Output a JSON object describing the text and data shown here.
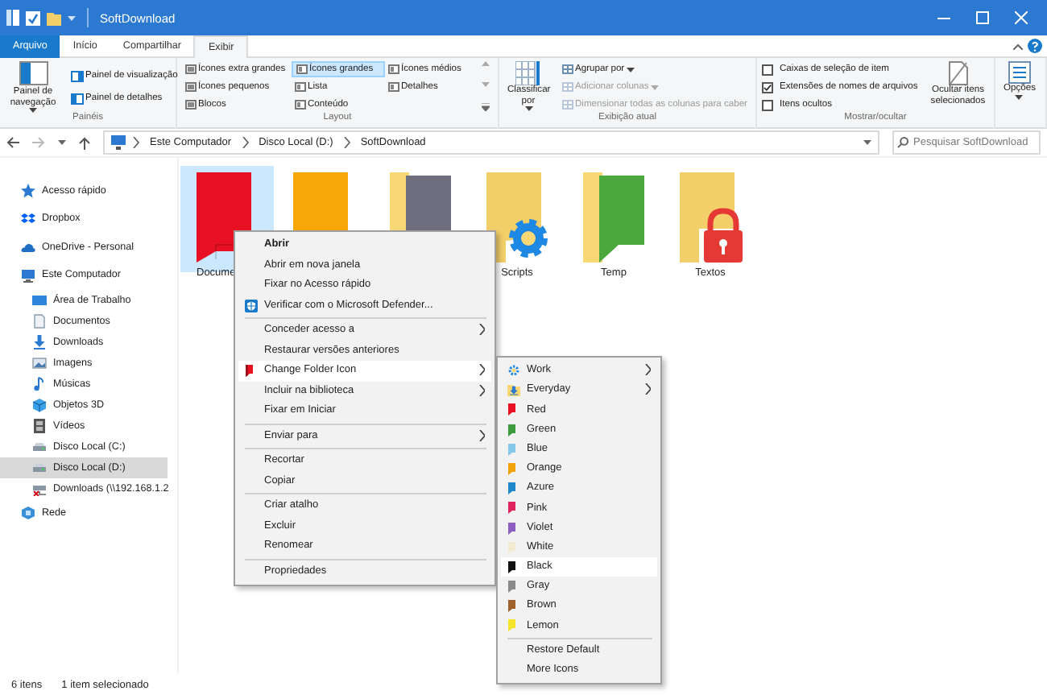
{
  "title_bar": {
    "title": "SoftDownload"
  },
  "ribbon": {
    "tabs": [
      {
        "label": "Arquivo",
        "kind": "file",
        "selected": false
      },
      {
        "label": "Início",
        "kind": "tab",
        "selected": false
      },
      {
        "label": "Compartilhar",
        "kind": "tab",
        "selected": false
      },
      {
        "label": "Exibir",
        "kind": "tab",
        "selected": true
      }
    ],
    "panes": {
      "label": "Painéis",
      "navigation_pane": "Painel de navegação",
      "buttons": [
        "Painel de visualização",
        "Painel de detalhes"
      ]
    },
    "layout": {
      "label": "Layout",
      "options": [
        {
          "label": "Ícones extra grandes",
          "selected": false
        },
        {
          "label": "Ícones grandes",
          "selected": true
        },
        {
          "label": "Ícones médios",
          "selected": false
        },
        {
          "label": "Ícones pequenos",
          "selected": false
        },
        {
          "label": "Lista",
          "selected": false
        },
        {
          "label": "Detalhes",
          "selected": false
        },
        {
          "label": "Blocos",
          "selected": false
        },
        {
          "label": "Conteúdo",
          "selected": false
        }
      ]
    },
    "current_view": {
      "label": "Exibição atual",
      "sort_by": "Classificar por",
      "commands": [
        {
          "label": "Agrupar por",
          "disabled": false,
          "dropdown": true
        },
        {
          "label": "Adicionar colunas",
          "disabled": true,
          "dropdown": true
        },
        {
          "label": "Dimensionar todas as colunas para caber",
          "disabled": true,
          "dropdown": false
        }
      ]
    },
    "show_hide": {
      "label": "Mostrar/ocultar",
      "checkboxes": [
        {
          "label": "Caixas de seleção de item",
          "checked": false
        },
        {
          "label": "Extensões de nomes de arquivos",
          "checked": true
        },
        {
          "label": "Itens ocultos",
          "checked": false
        }
      ],
      "hide_selected": "Ocultar itens selecionados"
    },
    "options": "Opções"
  },
  "address_bar": {
    "path": [
      "Este Computador",
      "Disco Local (D:)",
      "SoftDownload"
    ]
  },
  "search": {
    "placeholder": "Pesquisar SoftDownload"
  },
  "sidebar": {
    "items": [
      {
        "label": "Acesso rápido",
        "kind": "star",
        "selected": false
      },
      {
        "label": "Dropbox",
        "kind": "dropbox",
        "selected": false
      },
      {
        "label": "OneDrive - Personal",
        "kind": "cloud",
        "selected": false
      },
      {
        "label": "Este Computador",
        "kind": "computer",
        "selected": false,
        "children": [
          {
            "label": "Área de Trabalho",
            "kind": "desktop",
            "selected": false
          },
          {
            "label": "Documentos",
            "kind": "document",
            "selected": false
          },
          {
            "label": "Downloads",
            "kind": "download",
            "selected": false
          },
          {
            "label": "Imagens",
            "kind": "image",
            "selected": false
          },
          {
            "label": "Músicas",
            "kind": "music",
            "selected": false
          },
          {
            "label": "Objetos 3D",
            "kind": "cube",
            "selected": false
          },
          {
            "label": "Vídeos",
            "kind": "video",
            "selected": false
          },
          {
            "label": "Disco Local (C:)",
            "kind": "drive",
            "selected": false
          },
          {
            "label": "Disco Local (D:)",
            "kind": "drive",
            "selected": true
          },
          {
            "label": "Downloads (\\\\192.168.1.2",
            "kind": "network-drive",
            "selected": false
          }
        ]
      },
      {
        "label": "Rede",
        "kind": "network",
        "selected": false
      }
    ]
  },
  "files": [
    {
      "name": "Docume",
      "kind": "solid",
      "color": "#e81123",
      "selected": true
    },
    {
      "kind": "solid",
      "color": "#f7a707",
      "selected": false
    },
    {
      "kind": "front",
      "color": "#6e6e7e",
      "selected": false
    },
    {
      "name": "Scripts",
      "kind": "gear",
      "color": "#f3cf6a",
      "selected": false
    },
    {
      "name": "Temp",
      "kind": "front",
      "color": "#4aa83c",
      "selected": false
    },
    {
      "name": "Textos",
      "kind": "lock",
      "color": "#f3cf6a",
      "selected": false
    }
  ],
  "context_menu": {
    "items": [
      {
        "kind": "item",
        "label": "Abrir",
        "bold": true,
        "submenu": false,
        "highlighted": false
      },
      {
        "kind": "item",
        "label": "Abrir em nova janela",
        "bold": false,
        "submenu": false,
        "highlighted": false
      },
      {
        "kind": "item",
        "label": "Fixar no Acesso rápido",
        "bold": false,
        "submenu": false,
        "highlighted": false
      },
      {
        "kind": "shield",
        "label": "Verificar com o Microsoft Defender...",
        "bold": false,
        "submenu": false,
        "highlighted": false
      },
      {
        "kind": "separator"
      },
      {
        "kind": "item",
        "label": "Conceder acesso a",
        "bold": false,
        "submenu": true,
        "highlighted": false
      },
      {
        "kind": "item",
        "label": "Restaurar versões anteriores",
        "bold": false,
        "submenu": false,
        "highlighted": false
      },
      {
        "kind": "flag",
        "label": "Change Folder Icon",
        "bold": false,
        "submenu": true,
        "highlighted": true
      },
      {
        "kind": "item",
        "label": "Incluir na biblioteca",
        "bold": false,
        "submenu": true,
        "highlighted": false
      },
      {
        "kind": "item",
        "label": "Fixar em Iniciar",
        "bold": false,
        "submenu": false,
        "highlighted": false
      },
      {
        "kind": "separator"
      },
      {
        "kind": "item",
        "label": "Enviar para",
        "bold": false,
        "submenu": true,
        "highlighted": false
      },
      {
        "kind": "separator"
      },
      {
        "kind": "item",
        "label": "Recortar",
        "bold": false,
        "submenu": false,
        "highlighted": false
      },
      {
        "kind": "item",
        "label": "Copiar",
        "bold": false,
        "submenu": false,
        "highlighted": false
      },
      {
        "kind": "separator"
      },
      {
        "kind": "item",
        "label": "Criar atalho",
        "bold": false,
        "submenu": false,
        "highlighted": false
      },
      {
        "kind": "item",
        "label": "Excluir",
        "bold": false,
        "submenu": false,
        "highlighted": false
      },
      {
        "kind": "item",
        "label": "Renomear",
        "bold": false,
        "submenu": false,
        "highlighted": false
      },
      {
        "kind": "separator"
      },
      {
        "kind": "item",
        "label": "Propriedades",
        "bold": false,
        "submenu": false,
        "highlighted": false
      }
    ]
  },
  "submenu": {
    "items": [
      {
        "kind": "gear",
        "label": "Work",
        "submenu": true,
        "highlighted": false
      },
      {
        "kind": "download",
        "label": "Everyday",
        "submenu": true,
        "highlighted": false
      },
      {
        "kind": "swatch",
        "label": "Red",
        "color": "#e81123",
        "submenu": false,
        "highlighted": false
      },
      {
        "kind": "swatch",
        "label": "Green",
        "color": "#3a9c3a",
        "submenu": false,
        "highlighted": false
      },
      {
        "kind": "swatch",
        "label": "Blue",
        "color": "#86c8ea",
        "submenu": false,
        "highlighted": false
      },
      {
        "kind": "swatch",
        "label": "Orange",
        "color": "#f0a30a",
        "submenu": false,
        "highlighted": false
      },
      {
        "kind": "swatch",
        "label": "Azure",
        "color": "#1e88c8",
        "submenu": false,
        "highlighted": false
      },
      {
        "kind": "swatch",
        "label": "Pink",
        "color": "#e0245e",
        "submenu": false,
        "highlighted": false
      },
      {
        "kind": "swatch",
        "label": "Violet",
        "color": "#8c5fc0",
        "submenu": false,
        "highlighted": false
      },
      {
        "kind": "swatch",
        "label": "White",
        "color": "#f3ead2",
        "submenu": false,
        "highlighted": false
      },
      {
        "kind": "swatch",
        "label": "Black",
        "color": "#111111",
        "submenu": false,
        "highlighted": true
      },
      {
        "kind": "swatch",
        "label": "Gray",
        "color": "#8a8a8a",
        "submenu": false,
        "highlighted": false
      },
      {
        "kind": "swatch",
        "label": "Brown",
        "color": "#a0622a",
        "submenu": false,
        "highlighted": false
      },
      {
        "kind": "swatch",
        "label": "Lemon",
        "color": "#f5e52a",
        "submenu": false,
        "highlighted": false
      },
      {
        "kind": "separator"
      },
      {
        "kind": "item",
        "label": "Restore Default",
        "submenu": false,
        "highlighted": false
      },
      {
        "kind": "item",
        "label": "More Icons",
        "submenu": false,
        "highlighted": false
      }
    ]
  },
  "status_bar": {
    "item_count": "6 itens",
    "selection": "1 item selecionado"
  }
}
